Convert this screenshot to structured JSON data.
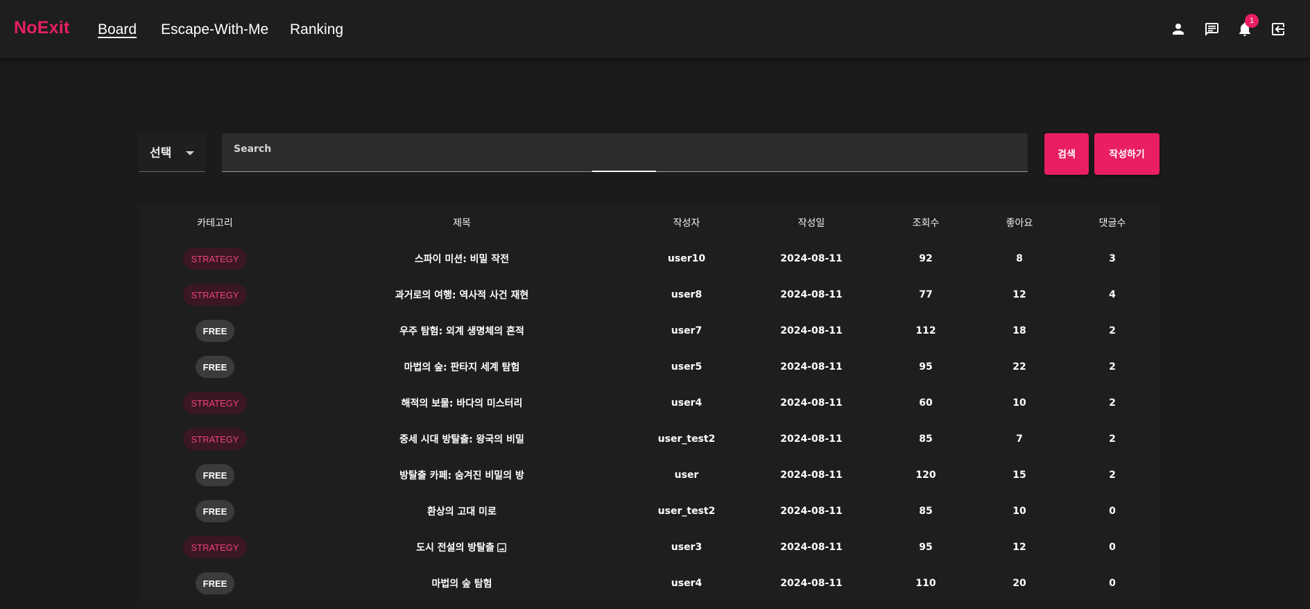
{
  "app": {
    "logo": "NoExit",
    "nav": [
      {
        "label": "Board",
        "active": true
      },
      {
        "label": "Escape-With-Me",
        "active": false
      },
      {
        "label": "Ranking",
        "active": false
      }
    ],
    "icons": [
      "account-icon",
      "chat-icon",
      "notifications-icon",
      "logout-icon"
    ],
    "notification_count": "1",
    "accent_color": "#e91e63"
  },
  "search": {
    "select_value": "선택",
    "placeholder": "Search",
    "value": "",
    "search_button": "검색",
    "write_button": "작성하기"
  },
  "table": {
    "headers": [
      "카테고리",
      "제목",
      "작성자",
      "작성일",
      "조회수",
      "좋아요",
      "댓글수"
    ],
    "rows": [
      {
        "category": "STRATEGY",
        "title": "스파이 미션: 비밀 작전",
        "author": "user10",
        "date": "2024-08-11",
        "views": "92",
        "likes": "8",
        "comments": "3",
        "has_image": false
      },
      {
        "category": "STRATEGY",
        "title": "과거로의 여행: 역사적 사건 재현",
        "author": "user8",
        "date": "2024-08-11",
        "views": "77",
        "likes": "12",
        "comments": "4",
        "has_image": false
      },
      {
        "category": "FREE",
        "title": "우주 탐험: 외계 생명체의 흔적",
        "author": "user7",
        "date": "2024-08-11",
        "views": "112",
        "likes": "18",
        "comments": "2",
        "has_image": false
      },
      {
        "category": "FREE",
        "title": "마법의 숲: 판타지 세계 탐험",
        "author": "user5",
        "date": "2024-08-11",
        "views": "95",
        "likes": "22",
        "comments": "2",
        "has_image": false
      },
      {
        "category": "STRATEGY",
        "title": "해적의 보물: 바다의 미스터리",
        "author": "user4",
        "date": "2024-08-11",
        "views": "60",
        "likes": "10",
        "comments": "2",
        "has_image": false
      },
      {
        "category": "STRATEGY",
        "title": "중세 시대 방탈출: 왕국의 비밀",
        "author": "user_test2",
        "date": "2024-08-11",
        "views": "85",
        "likes": "7",
        "comments": "2",
        "has_image": false
      },
      {
        "category": "FREE",
        "title": "방탈출 카페: 숨겨진 비밀의 방",
        "author": "user",
        "date": "2024-08-11",
        "views": "120",
        "likes": "15",
        "comments": "2",
        "has_image": false
      },
      {
        "category": "FREE",
        "title": "환상의 고대 미로",
        "author": "user_test2",
        "date": "2024-08-11",
        "views": "85",
        "likes": "10",
        "comments": "0",
        "has_image": false
      },
      {
        "category": "STRATEGY",
        "title": "도시 전설의 방탈출",
        "author": "user3",
        "date": "2024-08-11",
        "views": "95",
        "likes": "12",
        "comments": "0",
        "has_image": true
      },
      {
        "category": "FREE",
        "title": "마법의 숲 탐험",
        "author": "user4",
        "date": "2024-08-11",
        "views": "110",
        "likes": "20",
        "comments": "0",
        "has_image": false
      }
    ]
  }
}
